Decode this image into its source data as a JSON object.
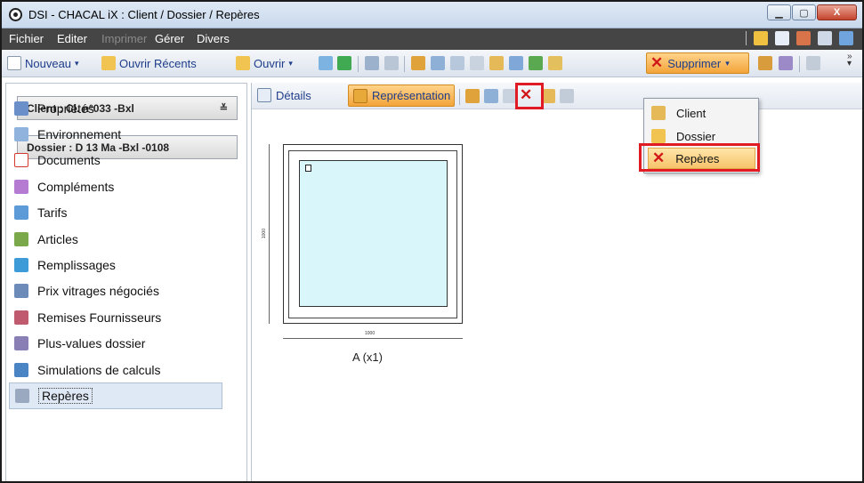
{
  "window": {
    "title": "DSI - CHACAL iX : Client / Dossier / Repères",
    "controls": {
      "minimize": "▁",
      "maximize": "▢",
      "close": "X"
    }
  },
  "menubar": {
    "items": [
      {
        "label": "Fichier",
        "enabled": true
      },
      {
        "label": "Editer",
        "enabled": true
      },
      {
        "label": "Imprimer",
        "enabled": false
      },
      {
        "label": "Gérer",
        "enabled": true
      },
      {
        "label": "Divers",
        "enabled": true
      }
    ],
    "right_icons": [
      "home-icon",
      "edit-icon",
      "tools-icon",
      "panel-icon",
      "list-icon"
    ]
  },
  "toolbar": {
    "nouveau": "Nouveau",
    "ouvrir_recents": "Ouvrir Récents",
    "ouvrir": "Ouvrir",
    "supprimer": "Supprimer"
  },
  "left_panel": {
    "client_combo": "Client : Cl. n°033 -Bxl",
    "dossier_combo": "Dossier : D 13 Ma -Bxl -0108",
    "nav_items": [
      {
        "label": "Propriétés",
        "icon": "properties-icon",
        "color": "#6b8fc9"
      },
      {
        "label": "Environnement",
        "icon": "environment-icon",
        "color": "#8fb3dc"
      },
      {
        "label": "Documents",
        "icon": "pdf-icon",
        "color": "#d23a2f"
      },
      {
        "label": "Compléments",
        "icon": "complements-icon",
        "color": "#b57ad1"
      },
      {
        "label": "Tarifs",
        "icon": "tariffs-icon",
        "color": "#5d9bd8"
      },
      {
        "label": "Articles",
        "icon": "articles-icon",
        "color": "#7ba84b"
      },
      {
        "label": "Remplissages",
        "icon": "fillings-icon",
        "color": "#3d9cd8"
      },
      {
        "label": "Prix vitrages négociés",
        "icon": "glazing-price-icon",
        "color": "#6d8bb8"
      },
      {
        "label": "Remises Fournisseurs",
        "icon": "supplier-discount-icon",
        "color": "#c05b6f"
      },
      {
        "label": "Plus-values dossier",
        "icon": "surplus-icon",
        "color": "#8a7fb5"
      },
      {
        "label": "Simulations de calculs",
        "icon": "calculator-icon",
        "color": "#4b84c4"
      },
      {
        "label": "Repères",
        "icon": "marks-icon",
        "color": "#9aa9c0"
      }
    ],
    "selected": "Repères"
  },
  "sub_toolbar": {
    "details": "Détails",
    "representation": "Représentation"
  },
  "drawing": {
    "dimension_width": "1000",
    "dimension_height": "1000",
    "caption": "A (x1)"
  },
  "dropdown": {
    "items": [
      {
        "label": "Client",
        "icon": "client-delete-icon"
      },
      {
        "label": "Dossier",
        "icon": "dossier-delete-icon"
      },
      {
        "label": "Repères",
        "icon": "marks-delete-icon"
      }
    ],
    "highlighted": "Repères"
  },
  "colors": {
    "menubar_bg": "#454545",
    "accent_orange": "#f3a43a",
    "highlight_red": "#e01b24",
    "glass": "#d9f7fa",
    "link_blue": "#1e3d8a"
  }
}
